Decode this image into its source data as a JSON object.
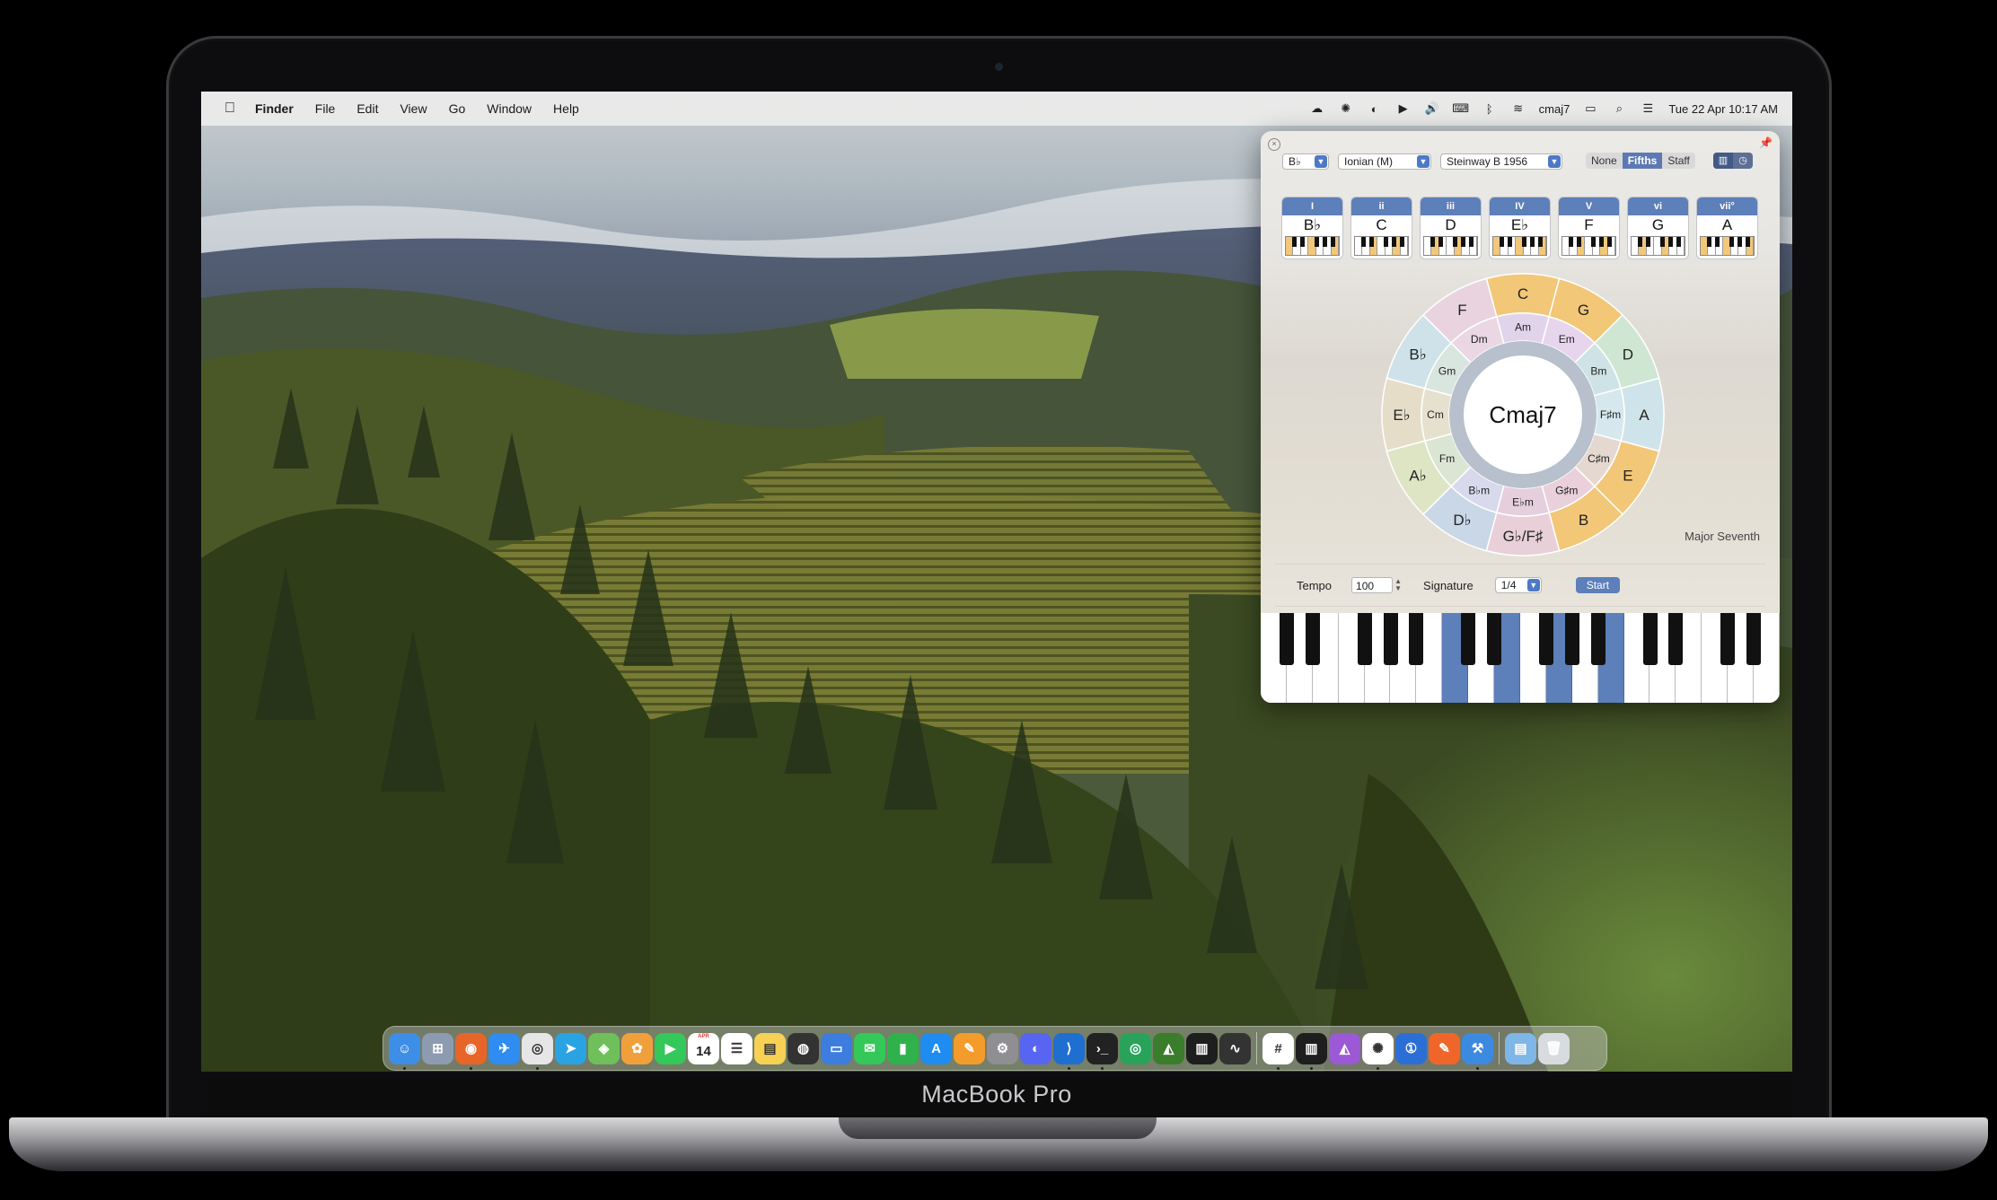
{
  "device": {
    "label": "MacBook Pro"
  },
  "menubar": {
    "app_name": "Finder",
    "items": [
      "File",
      "Edit",
      "View",
      "Go",
      "Window",
      "Help"
    ],
    "status_chord": "cmaj7",
    "datetime": "Tue 22 Apr  10:17 AM"
  },
  "app": {
    "key": "B♭",
    "mode": "Ionian (M)",
    "instrument": "Steinway B 1956",
    "display_modes": [
      "None",
      "Fifths",
      "Staff"
    ],
    "active_display_mode": "Fifths",
    "degrees": [
      {
        "roman": "I",
        "chord": "B♭"
      },
      {
        "roman": "ii",
        "chord": "C"
      },
      {
        "roman": "iii",
        "chord": "D"
      },
      {
        "roman": "IV",
        "chord": "E♭"
      },
      {
        "roman": "V",
        "chord": "F"
      },
      {
        "roman": "vi",
        "chord": "G"
      },
      {
        "roman": "vii°",
        "chord": "A"
      }
    ],
    "wheel": {
      "center": "Cmaj7",
      "outer": [
        "C",
        "G",
        "D",
        "A",
        "E",
        "B",
        "G♭/F♯",
        "D♭",
        "A♭",
        "E♭",
        "B♭",
        "F"
      ],
      "inner": [
        "Am",
        "Em",
        "Bm",
        "F♯m",
        "C♯m",
        "G♯m",
        "E♭m",
        "B♭m",
        "Fm",
        "Cm",
        "Gm",
        "Dm"
      ],
      "highlighted_outer": [
        "C",
        "G",
        "E",
        "B"
      ]
    },
    "chord_quality": "Major Seventh",
    "tempo_label": "Tempo",
    "tempo_value": "100",
    "signature_label": "Signature",
    "signature_value": "1/4",
    "start_label": "Start",
    "accent_color": "#5d7fba",
    "highlight_color": "#f2c778"
  },
  "dock": {
    "apps": [
      "finder-icon",
      "launchpad-icon",
      "firefox-icon",
      "safari-icon",
      "chrome-icon",
      "telegram-icon",
      "maps-icon",
      "photos-icon",
      "facetime-icon",
      "calendar-icon",
      "reminders-icon",
      "notes-icon",
      "blender-icon",
      "keynote-icon",
      "messages-icon",
      "numbers-icon",
      "appstore-icon",
      "pages-icon",
      "settings-icon",
      "discord-icon",
      "vscode-icon",
      "terminal-icon",
      "chrome-canary-icon",
      "affinity-icon",
      "soulver-icon",
      "voice-memos-icon"
    ],
    "apps2": [
      "slack-icon",
      "activity-monitor-icon",
      "affinity-designer-icon",
      "chatgpt-icon",
      "1password-icon",
      "vectornator-icon",
      "xcode-icon"
    ],
    "calendar_day": "14",
    "calendar_month": "APR"
  }
}
